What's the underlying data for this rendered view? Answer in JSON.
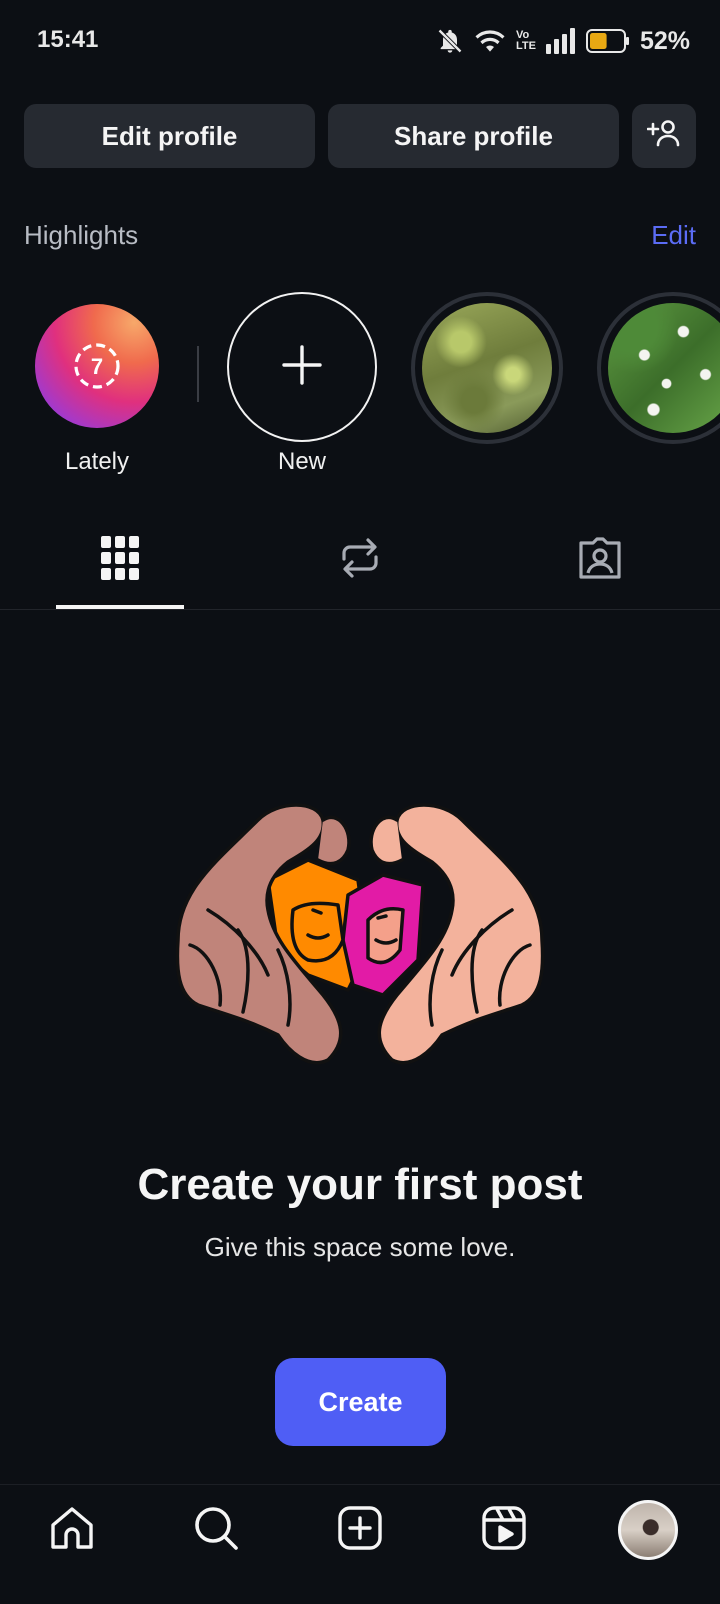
{
  "status_bar": {
    "time": "15:41",
    "battery_percent": "52%",
    "icons": [
      "bell-muted-icon",
      "wifi-icon",
      "volte-icon",
      "signal-icon",
      "battery-icon"
    ],
    "volte_label_top": "Vo",
    "volte_label_bottom": "LTE",
    "battery_level": 0.52,
    "battery_color": "#e8a813"
  },
  "profile_actions": {
    "edit_label": "Edit profile",
    "share_label": "Share profile",
    "add_user_icon": "add-user-icon"
  },
  "highlights": {
    "title": "Highlights",
    "edit_label": "Edit",
    "items": [
      {
        "label": "Lately",
        "badge": "7",
        "type": "lately"
      },
      {
        "label": "New",
        "type": "new"
      },
      {
        "label": "",
        "type": "photo"
      },
      {
        "label": "",
        "type": "photo"
      }
    ]
  },
  "tabs": [
    {
      "name": "grid",
      "icon": "grid-icon",
      "selected": true
    },
    {
      "name": "reposts",
      "icon": "repost-icon",
      "selected": false
    },
    {
      "name": "tagged",
      "icon": "tagged-icon",
      "selected": false
    }
  ],
  "empty_state": {
    "title": "Create your first post",
    "subtitle": "Give this space some love.",
    "button_label": "Create"
  },
  "bottom_nav": [
    {
      "name": "home",
      "icon": "home-icon"
    },
    {
      "name": "search",
      "icon": "search-icon"
    },
    {
      "name": "create",
      "icon": "plus-square-icon"
    },
    {
      "name": "reels",
      "icon": "reels-icon"
    },
    {
      "name": "profile",
      "icon": "avatar"
    }
  ],
  "colors": {
    "background": "#0c0f14",
    "button_bg": "#262a31",
    "accent": "#4f5ef5",
    "link": "#5b6cf5"
  }
}
